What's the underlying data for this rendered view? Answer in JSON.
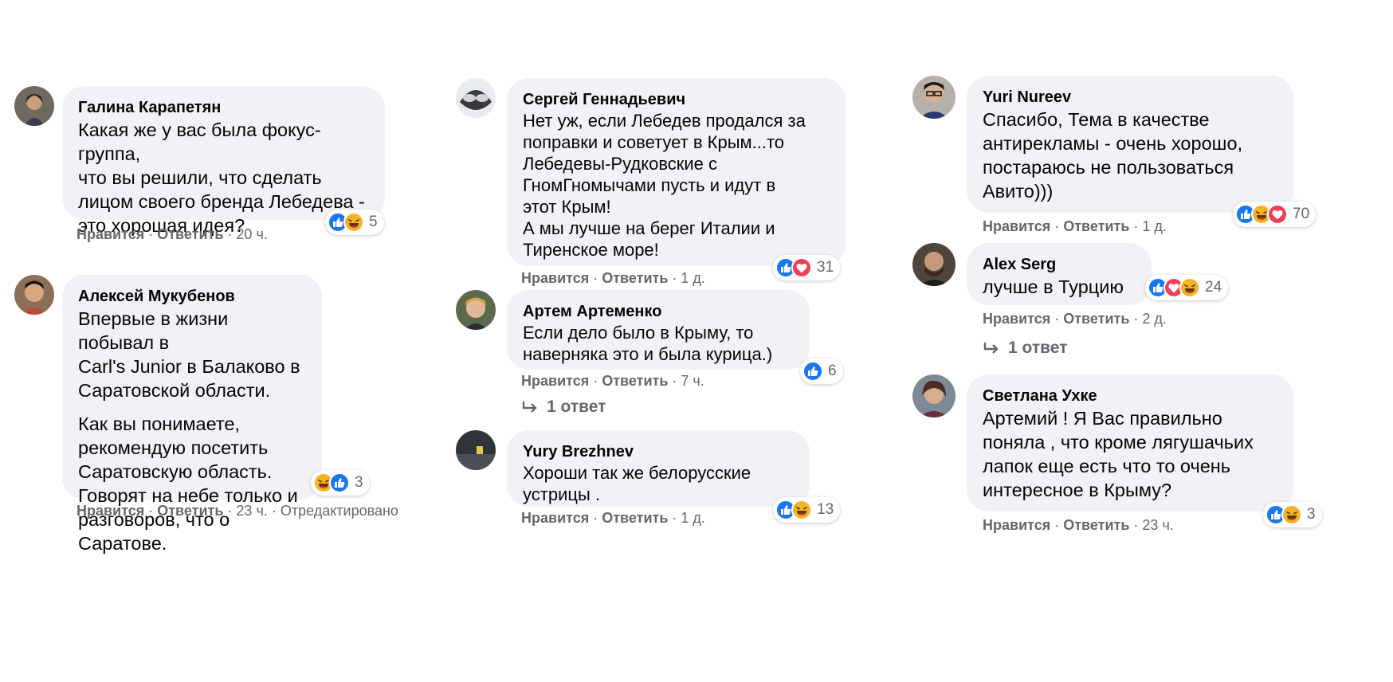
{
  "colors": {
    "like": "#1877f2",
    "love": "#f33e58",
    "haha": "#f7b125",
    "bubble": "#f0f2f5",
    "meta": "#65676b"
  },
  "comments": [
    {
      "author": "Галина Карапетян",
      "text": [
        "Какая же у вас была фокус-группа,\nчто вы решили, что сделать\nлицом своего бренда Лебедева -\nэто хорошая идея?"
      ],
      "like": "Нравится",
      "reply": "Ответить",
      "time": "20 ч.",
      "edited": "",
      "reactions": [
        "like",
        "haha"
      ],
      "reaction_count": "5"
    },
    {
      "author": "Алексей Мукубенов",
      "text": [
        "Впервые в жизни побывал в\nCarl's Junior в Балаково в\nСаратовской области.",
        "Как вы понимаете,\nрекомендую посетить\nСаратовскую область.\nГоворят на небе только и\nразговоров, что о Саратове."
      ],
      "like": "Нравится",
      "reply": "Ответить",
      "time": "23 ч.",
      "edited": "Отредактировано",
      "reactions": [
        "haha",
        "like"
      ],
      "reaction_count": "3"
    },
    {
      "author": "Сергей Геннадьевич",
      "text": [
        "Нет уж, если Лебедев продался за\nпоправки и советует в Крым...то\nЛебедевы-Рудковские с\nГномГномычами пусть и идут в\nэтот Крым!\nА мы лучше на берег Италии и\nТиренское море!"
      ],
      "like": "Нравится",
      "reply": "Ответить",
      "time": "1 д.",
      "edited": "",
      "reactions": [
        "like",
        "love"
      ],
      "reaction_count": "31"
    },
    {
      "author": "Артем Артеменко",
      "text": [
        "Если дело было в Крыму, то\nнаверняка это и была курица.)"
      ],
      "like": "Нравится",
      "reply": "Ответить",
      "time": "7 ч.",
      "edited": "",
      "reactions": [
        "like"
      ],
      "reaction_count": "6",
      "replies": "1 ответ"
    },
    {
      "author": "Yury Brezhnev",
      "text": [
        "Хороши так же белорусские\nустрицы ."
      ],
      "like": "Нравится",
      "reply": "Ответить",
      "time": "1 д.",
      "edited": "",
      "reactions": [
        "like",
        "haha"
      ],
      "reaction_count": "13"
    },
    {
      "author": "Yuri Nureev",
      "text": [
        "Спасибо, Тема в качестве\nантирекламы - очень хорошо,\nпостараюсь не пользоваться\nАвито)))"
      ],
      "like": "Нравится",
      "reply": "Ответить",
      "time": "1 д.",
      "edited": "",
      "reactions": [
        "like",
        "haha",
        "love"
      ],
      "reaction_count": "70"
    },
    {
      "author": "Alex Serg",
      "text": [
        "лучше в Турцию"
      ],
      "like": "Нравится",
      "reply": "Ответить",
      "time": "2 д.",
      "edited": "",
      "reactions": [
        "like",
        "love",
        "haha"
      ],
      "reaction_count": "24",
      "replies": "1 ответ"
    },
    {
      "author": "Светлана Ухке",
      "text": [
        "Артемий ! Я Вас правильно\nпоняла , что кроме лягушачьих\nлапок еще есть что то очень\nинтересное в Крыму?"
      ],
      "like": "Нравится",
      "reply": "Ответить",
      "time": "23 ч.",
      "edited": "",
      "reactions": [
        "like",
        "haha"
      ],
      "reaction_count": "3"
    }
  ]
}
